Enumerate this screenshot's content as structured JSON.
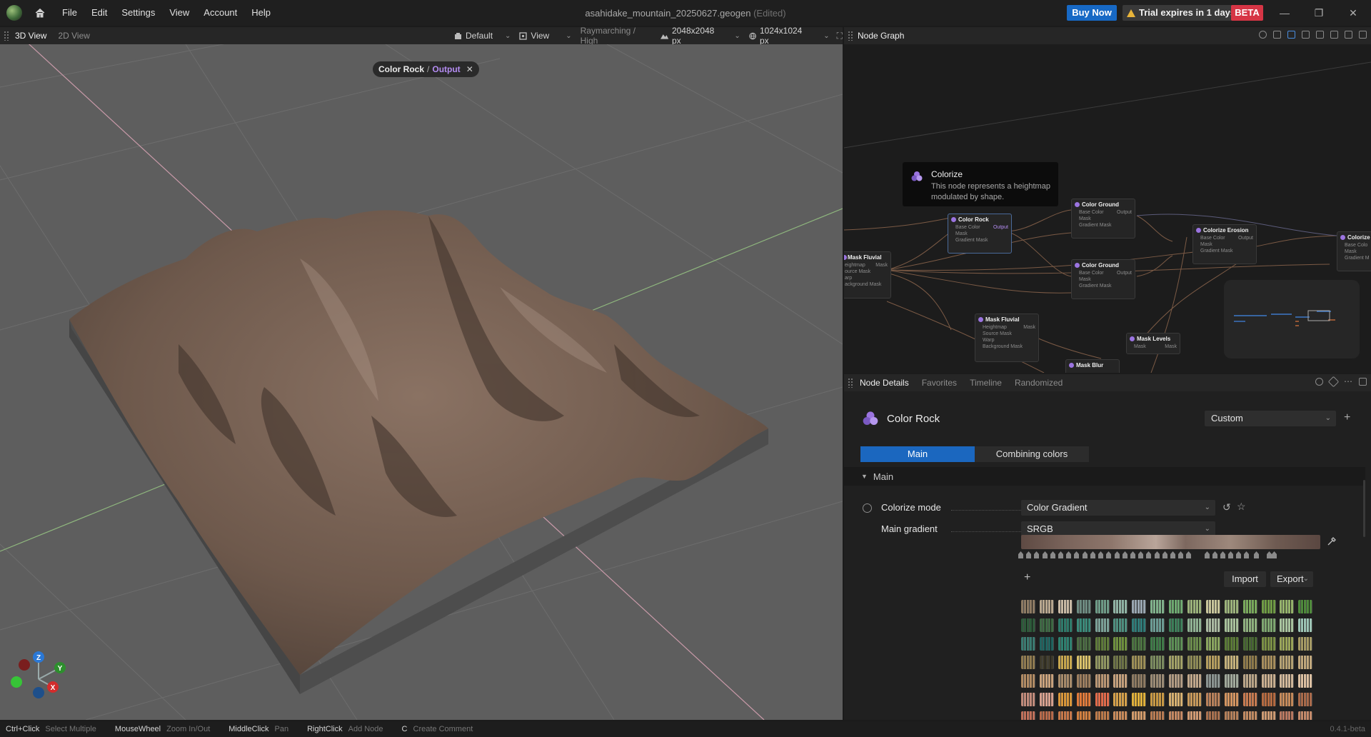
{
  "titlebar": {
    "menu": [
      "File",
      "Edit",
      "Settings",
      "View",
      "Account",
      "Help"
    ],
    "document": "asahidake_mountain_20250627.geogen",
    "document_state": "(Edited)",
    "buy_now": "Buy Now",
    "trial": "Trial expires in 1 days",
    "beta": "BETA"
  },
  "viewbar": {
    "tabs": [
      "3D View",
      "2D View"
    ],
    "camera": "Default",
    "view": "View",
    "render_mode": "Raymarching / High",
    "terrain_res": "2048x2048 px",
    "texture_res": "1024x1024 px"
  },
  "viewport": {
    "breadcrumb_node": "Color Rock",
    "breadcrumb_sep": "/",
    "breadcrumb_port": "Output",
    "axes": {
      "z": "Z",
      "y": "Y",
      "x": "X"
    }
  },
  "node_graph": {
    "title": "Node Graph",
    "tooltip": {
      "title": "Colorize",
      "body": "This node represents a heightmap modulated by shape."
    },
    "nodes": {
      "color_rock": {
        "title": "Color Rock",
        "ports": [
          "Base Color",
          "Mask",
          "Gradient Mask"
        ],
        "output": "Output"
      },
      "color_ground_1": {
        "title": "Color Ground",
        "ports": [
          "Base Color",
          "Mask",
          "Gradient Mask"
        ],
        "output": "Output"
      },
      "color_ground_2": {
        "title": "Color Ground",
        "ports": [
          "Base Color",
          "Mask",
          "Gradient Mask"
        ],
        "output": "Output"
      },
      "colorize_erosion": {
        "title": "Colorize Erosion",
        "ports": [
          "Base Color",
          "Mask",
          "Gradient Mask"
        ],
        "output": "Output"
      },
      "colorize_edge": {
        "title": "Colorize",
        "ports": [
          "Base Colo",
          "Mask",
          "Gradient M"
        ]
      },
      "mask_fluvial_1": {
        "title": "Mask Fluvial",
        "ports": [
          "eightmap",
          "ource Mask",
          "arp",
          "ackground Mask"
        ],
        "output": "Mask"
      },
      "mask_fluvial_2": {
        "title": "Mask Fluvial",
        "ports": [
          "Heightmap",
          "Source Mask",
          "Warp",
          "Background Mask"
        ],
        "output": "Mask"
      },
      "mask_levels": {
        "title": "Mask Levels",
        "ports": [
          "Mask"
        ],
        "output": "Mask"
      },
      "mask_blur": {
        "title": "Mask Blur"
      }
    }
  },
  "node_details": {
    "tabs": [
      "Node Details",
      "Favorites",
      "Timeline",
      "Randomized"
    ],
    "node_name": "Color Rock",
    "preset": "Custom",
    "subtabs": [
      "Main",
      "Combining colors"
    ],
    "section": "Main",
    "colorize_mode_label": "Colorize mode",
    "colorize_mode_value": "Color Gradient",
    "main_gradient_label": "Main gradient",
    "main_gradient_value": "SRGB",
    "import": "Import",
    "export": "Export"
  },
  "statusbar": {
    "hints": [
      {
        "key": "Ctrl+Click",
        "desc": "Select Multiple"
      },
      {
        "key": "MouseWheel",
        "desc": "Zoom In/Out"
      },
      {
        "key": "MiddleClick",
        "desc": "Pan"
      },
      {
        "key": "RightClick",
        "desc": "Add Node"
      },
      {
        "key": "C",
        "desc": "Create Comment"
      }
    ],
    "version": "0.4.1-beta"
  },
  "colors": {
    "accent": "#1b67bf",
    "beta": "#d63545",
    "node_purple": "#9b74e0",
    "viewport_bg": "#5e5e5e",
    "terrain": "#6f5a4e"
  }
}
